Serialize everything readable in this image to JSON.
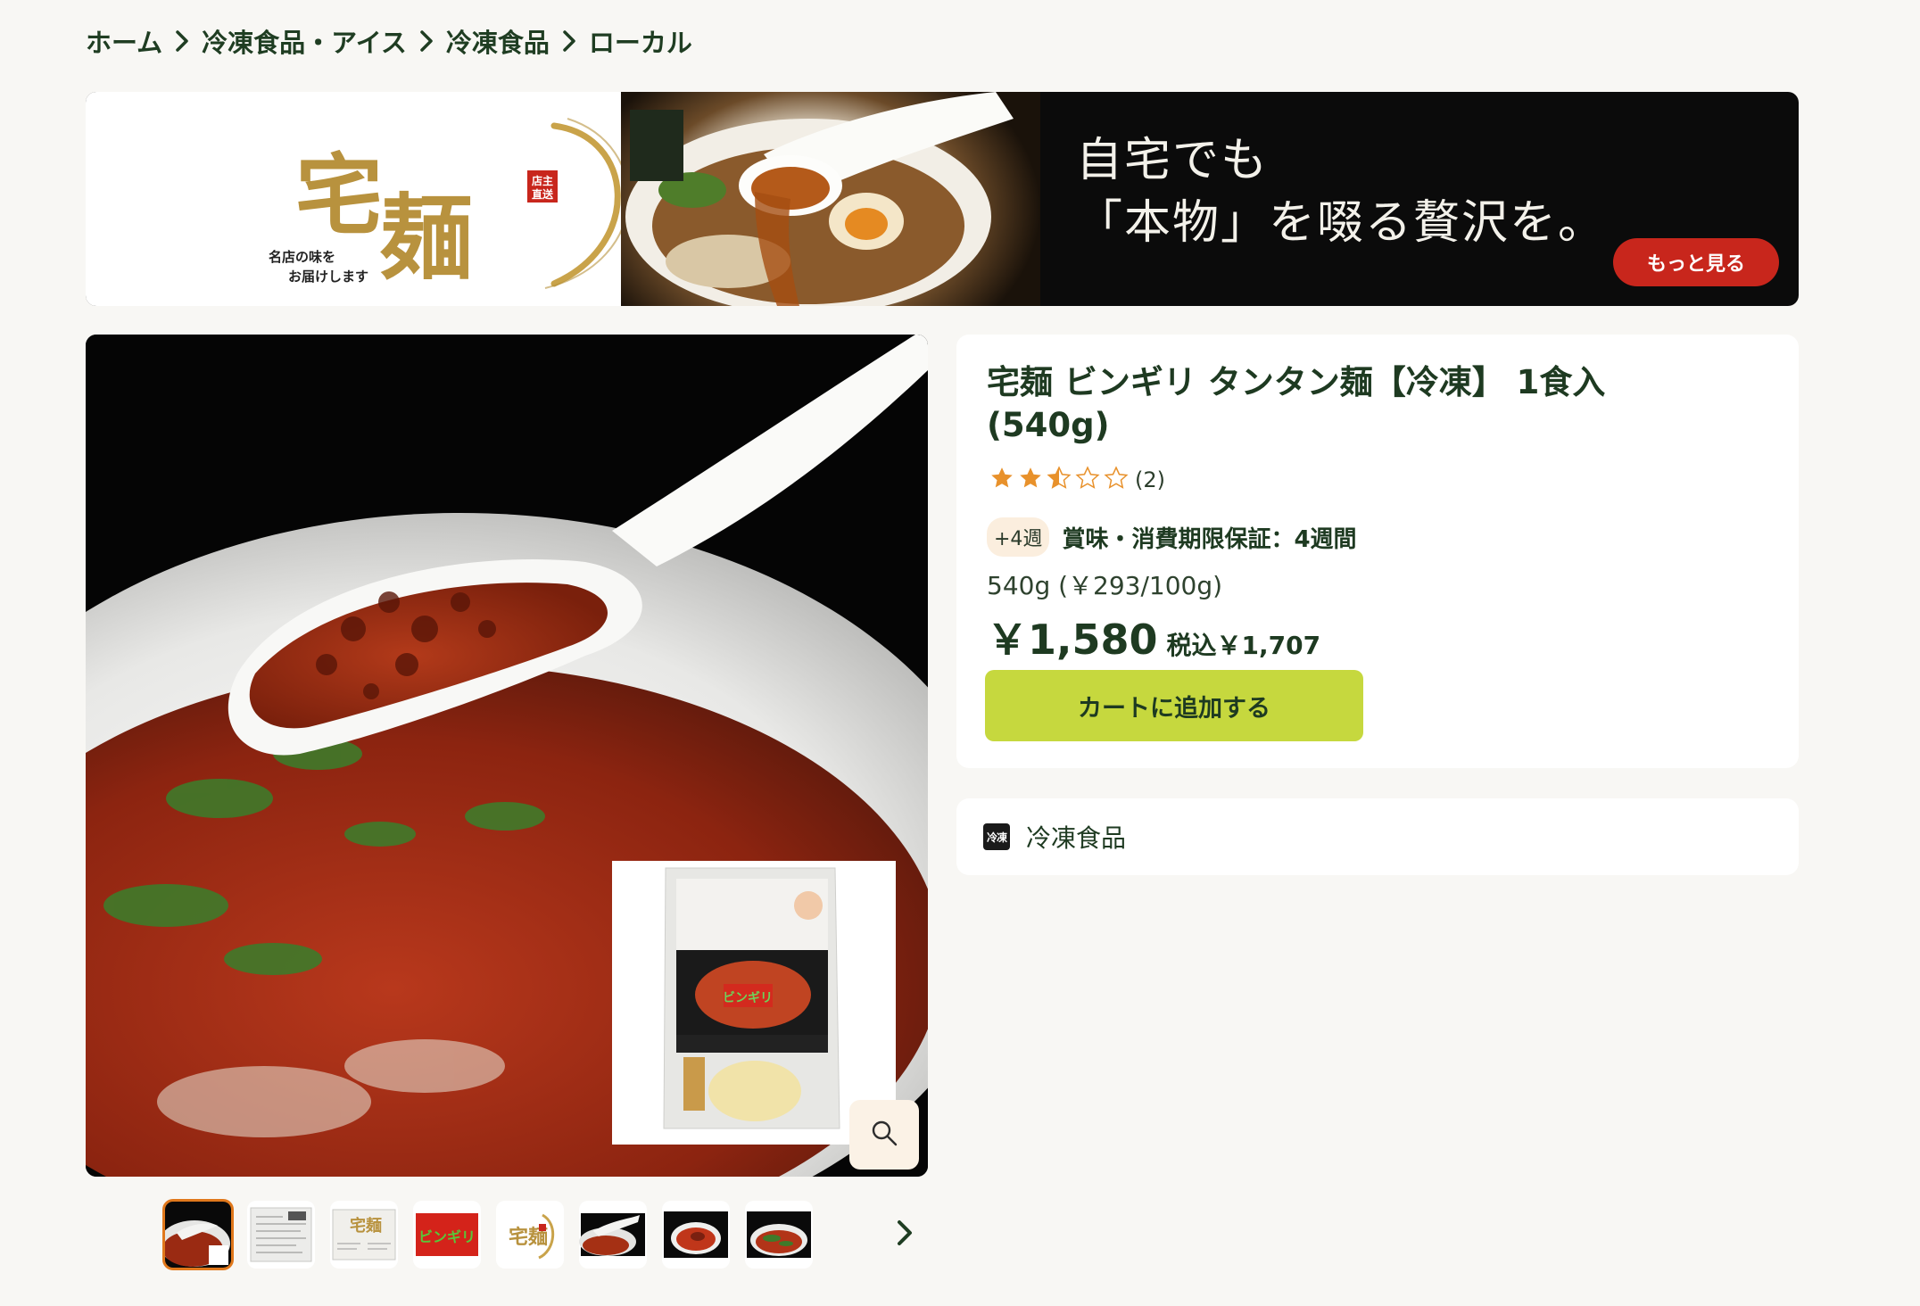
{
  "breadcrumb": [
    "ホーム",
    "冷凍食品・アイス",
    "冷凍食品",
    "ローカル"
  ],
  "banner": {
    "headline": "自宅でも\n「本物」を啜る贅沢を。",
    "button_label": "もっと見る",
    "logo_text": "宅麺",
    "logo_tagline": "名店の味を\nお届けします",
    "logo_seal": "店主直送"
  },
  "product": {
    "title": "宅麺 ビンギリ タンタン麺【冷凍】 1食入(540g)",
    "rating": 2.5,
    "rating_max": 5,
    "review_count": "(2)",
    "warranty_badge": "+4週",
    "warranty_text": "賞味・消費期限保証：4週間",
    "unit_price": "540g (￥293/100g)",
    "price": "￥1,580",
    "tax_price": "税込￥1,707",
    "cart_button": "カートに追加する"
  },
  "category": {
    "icon_text": "冷凍",
    "label": "冷凍食品"
  },
  "gallery": {
    "thumbnail_count": 8,
    "active_index": 0
  },
  "colors": {
    "accent_green": "#c6d83e",
    "text_dark_green": "#1e3a21",
    "banner_button_red": "#c8261c",
    "star": "#e8912b",
    "page_bg": "#f8f7f4"
  },
  "icons": {
    "zoom": "magnifier-icon",
    "breadcrumb_separator": "chevron-right-icon",
    "thumbs_next": "chevron-right-icon"
  }
}
